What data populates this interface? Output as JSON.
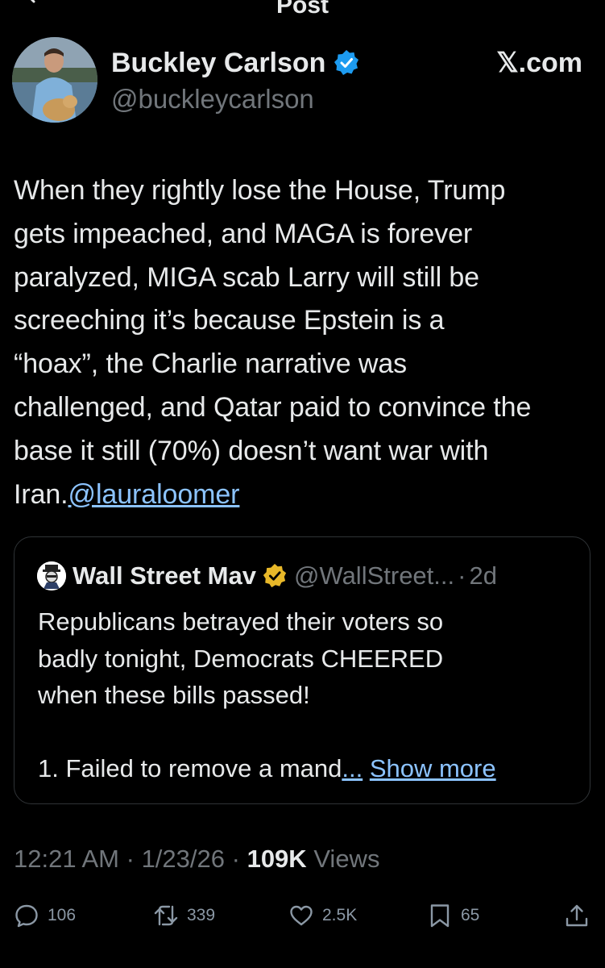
{
  "header": {
    "title": "Post"
  },
  "author": {
    "name": "Buckley Carlson",
    "handle": "@buckleycarlson",
    "source": "𝕏.com"
  },
  "tweet": {
    "lines": [
      "When they rightly lose the House, Trump",
      "gets impeached, and MAGA is forever",
      "paralyzed, MIGA scab Larry will still be",
      "screeching it’s because Epstein is a",
      "“hoax”, the Charlie  narrative was",
      "challenged, and Qatar paid to convince the",
      "base it still (70%) doesn’t want war with"
    ],
    "last_line_prefix": "Iran.",
    "mention": "@lauraloomer"
  },
  "quote": {
    "name": "Wall Street Mav",
    "handle": "@WallStreet...",
    "separator": "·",
    "time": "2d",
    "lines": [
      "Republicans betrayed their voters so",
      "badly tonight, Democrats CHEERED",
      "when these bills passed!"
    ],
    "truncated_line": "1. Failed to remove a mand",
    "ellipsis": "...",
    "show_more": "Show more"
  },
  "meta": {
    "time": "12:21 AM",
    "sep1": "·",
    "date": "1/23/26",
    "sep2": "·",
    "views_count": "109K",
    "views_label": "Views"
  },
  "actions": {
    "replies": "106",
    "reposts": "339",
    "likes": "2.5K",
    "bookmarks": "65"
  },
  "colors": {
    "background": "#000000",
    "text": "#e7e9ea",
    "secondary": "#71767b",
    "link": "#8cc3ff",
    "verified_blue": "#1d9bf0",
    "verified_gold": "#e8b829"
  }
}
